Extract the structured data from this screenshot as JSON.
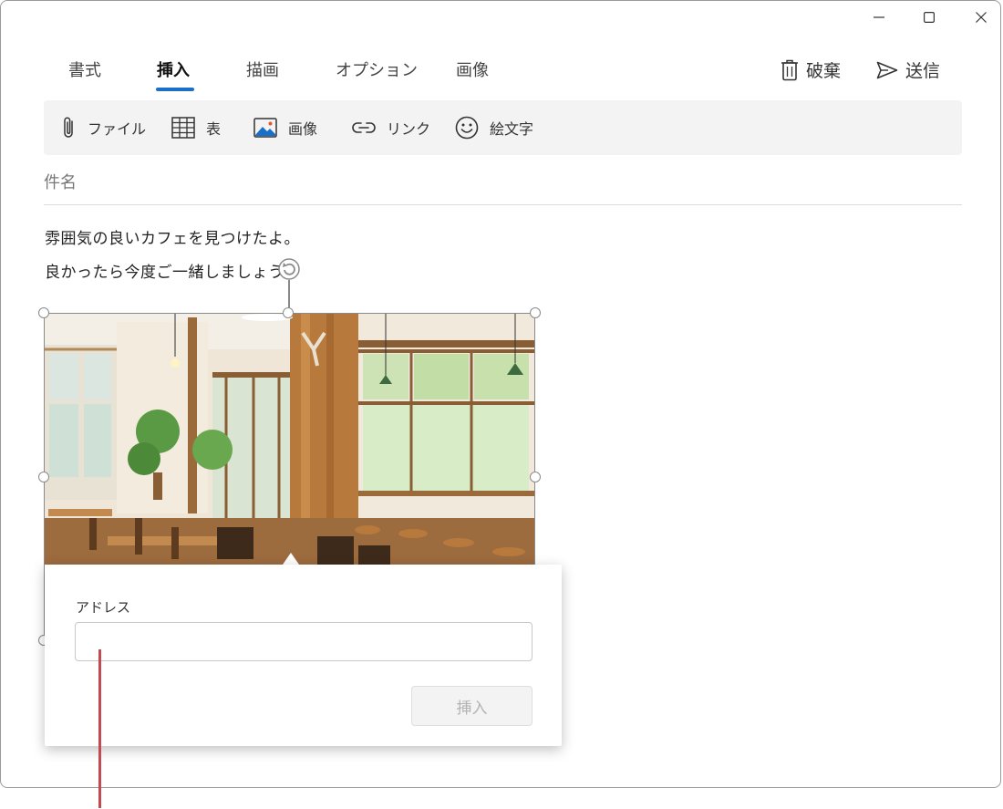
{
  "window": {
    "controls": [
      "minimize",
      "maximize",
      "close"
    ]
  },
  "tabs": [
    {
      "label": "書式",
      "active": false
    },
    {
      "label": "挿入",
      "active": true
    },
    {
      "label": "描画",
      "active": false
    },
    {
      "label": "オプション",
      "active": false
    },
    {
      "label": "画像",
      "active": false
    }
  ],
  "header_actions": {
    "discard": {
      "label": "破棄",
      "icon": "trash-icon"
    },
    "send": {
      "label": "送信",
      "icon": "send-icon"
    }
  },
  "ribbon": [
    {
      "label": "ファイル",
      "icon": "paperclip-icon"
    },
    {
      "label": "表",
      "icon": "table-icon"
    },
    {
      "label": "画像",
      "icon": "picture-icon"
    },
    {
      "label": "リンク",
      "icon": "link-icon"
    },
    {
      "label": "絵文字",
      "icon": "emoji-icon"
    }
  ],
  "subject": {
    "placeholder": "件名"
  },
  "body": {
    "lines": [
      "雰囲気の良いカフェを見つけたよ。",
      "良かったら今度ご一緒しましょう。"
    ]
  },
  "link_popover": {
    "label": "アドレス",
    "value": "",
    "insert_button": "挿入",
    "insert_enabled": false
  },
  "colors": {
    "accent": "#1a6fc9",
    "marker": "#c44a52",
    "ribbon_bg": "#f3f3f3"
  }
}
